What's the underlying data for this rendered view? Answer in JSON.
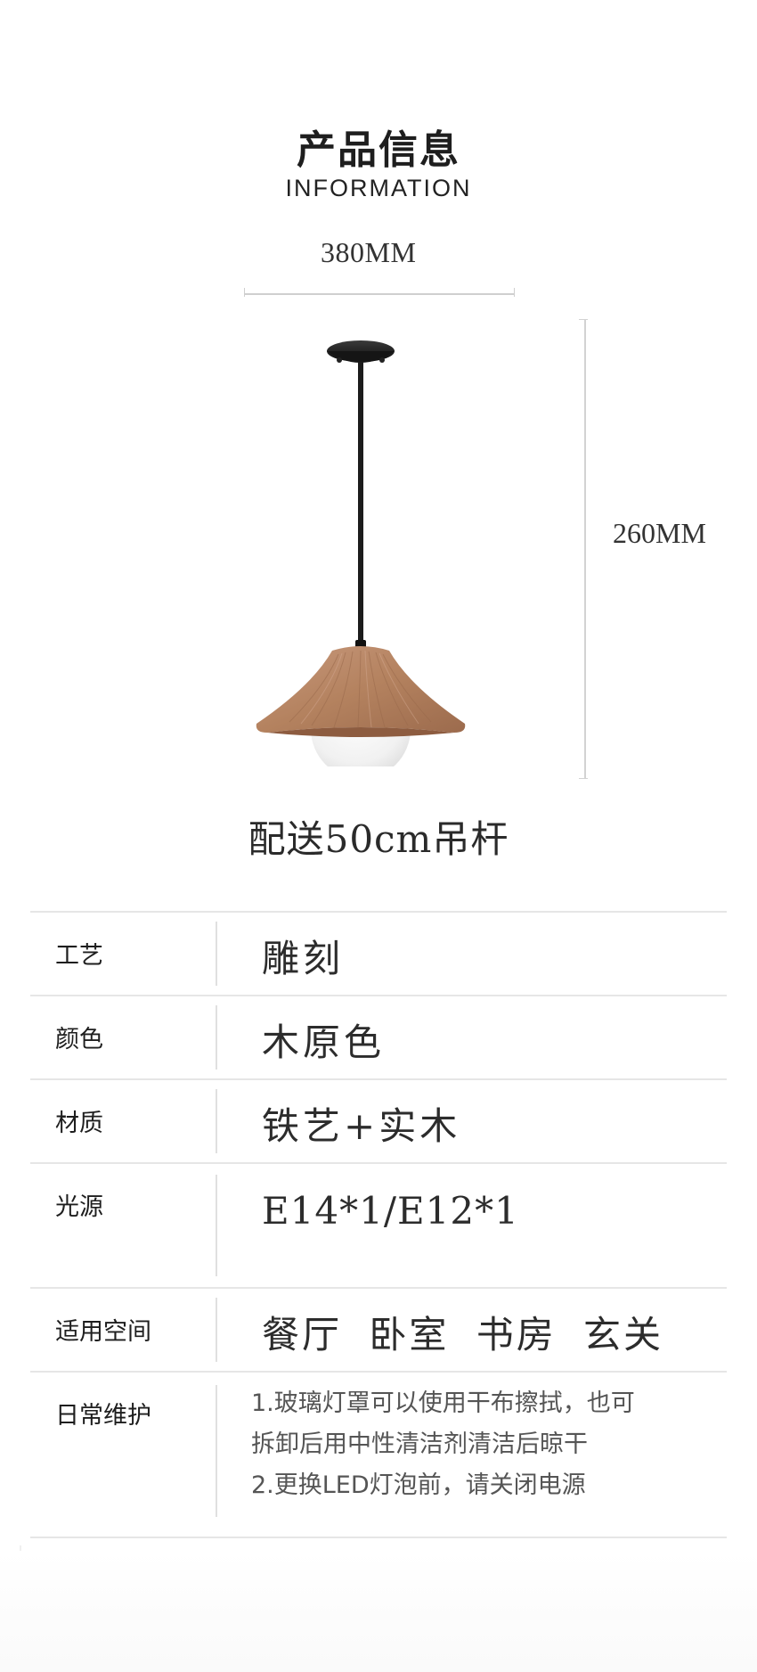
{
  "header": {
    "title": "产品信息",
    "subtitle": "INFORMATION"
  },
  "dimensions": {
    "width_label": "380MM",
    "height_label": "260MM"
  },
  "rod_note": "配送50cm吊杆",
  "specs": [
    {
      "label": "工艺",
      "value": "雕刻"
    },
    {
      "label": "颜色",
      "value": "木原色"
    },
    {
      "label": "材质",
      "value": "铁艺+实木"
    },
    {
      "label": "光源",
      "value": "E14*1/E12*1"
    },
    {
      "label": "适用空间",
      "value": "餐厅 卧室 书房 玄关"
    },
    {
      "label": "日常维护",
      "lines": [
        "1.玻璃灯罩可以使用干布擦拭，也可",
        "拆卸后用中性清洁剂清洁后晾干",
        "2.更换LED灯泡前，请关闭电源"
      ]
    }
  ],
  "colors": {
    "wood": "#b9876a",
    "metal": "#1c1c1c",
    "glass": "#f4f4f4",
    "rule": "#e6e6e6"
  }
}
